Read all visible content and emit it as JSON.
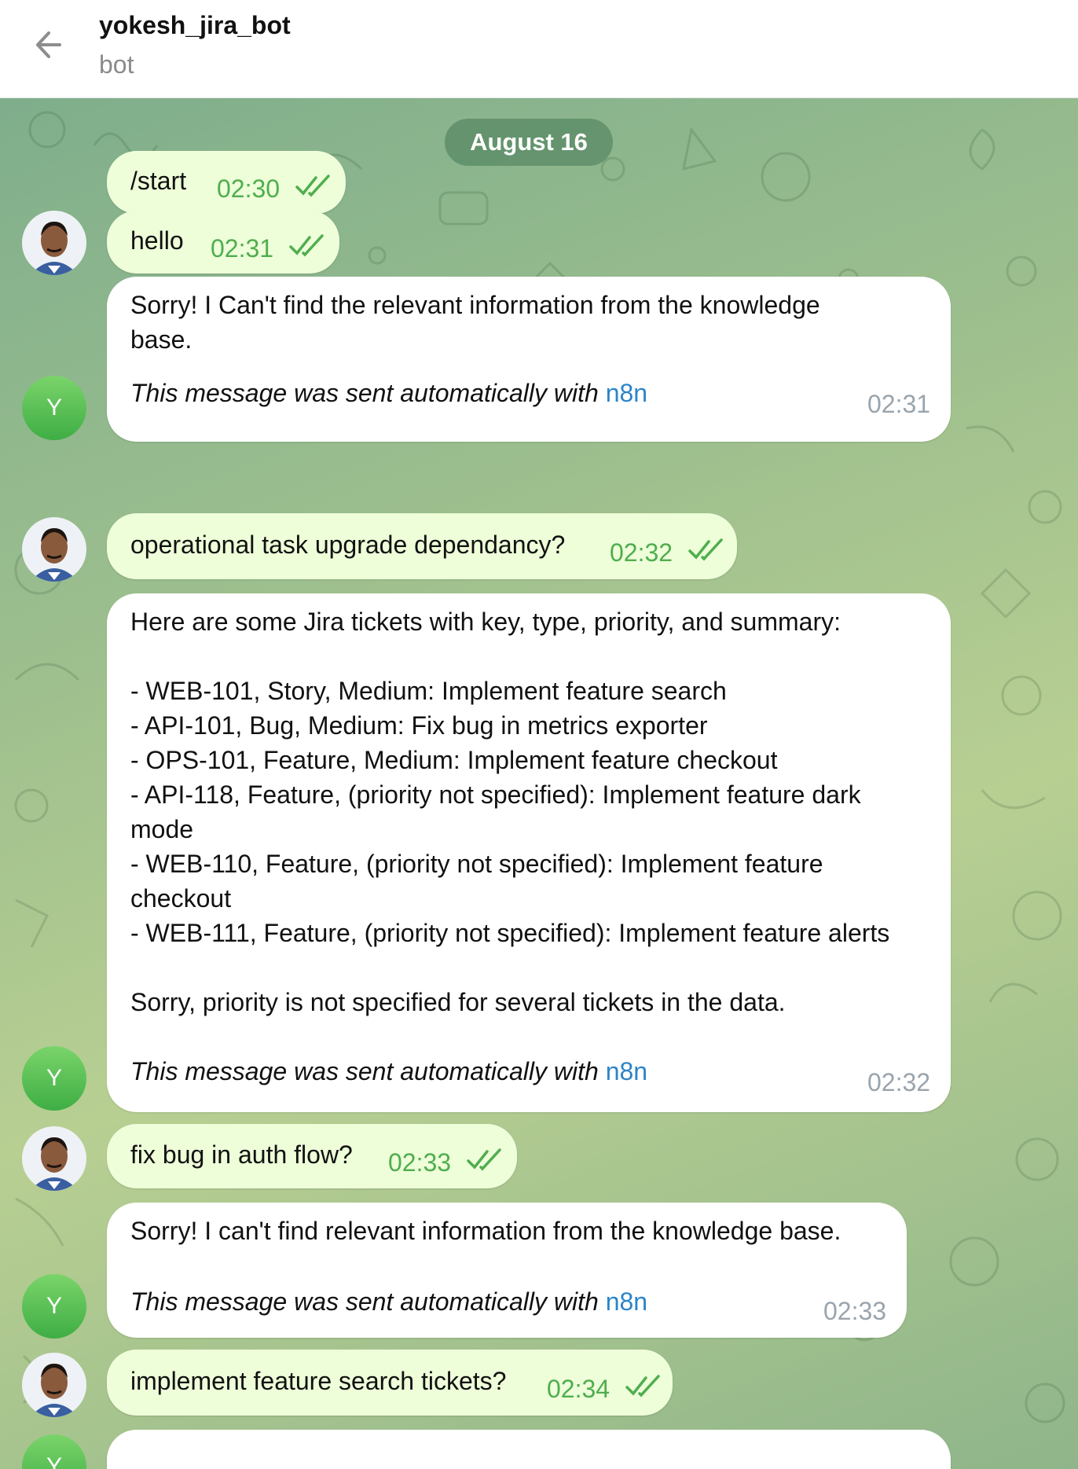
{
  "header": {
    "title": "yokesh_jira_bot",
    "subtitle": "bot"
  },
  "chat": {
    "date_label": "August 16",
    "bot_avatar_letter": "Y",
    "auto_prefix": "This message was sent automatically with",
    "auto_link": "n8n",
    "messages": [
      {
        "text": "/start",
        "time": "02:30"
      },
      {
        "text": "hello",
        "time": "02:31"
      },
      {
        "text": "Sorry! I Can't find the relevant information from the knowledge base.",
        "time": "02:31"
      },
      {
        "text": "operational task upgrade dependancy?",
        "time": "02:32"
      },
      {
        "text": "Here are some Jira tickets with key, type, priority, and summary:\n\n- WEB-101, Story, Medium: Implement feature search\n- API-101, Bug, Medium: Fix bug in metrics exporter\n- OPS-101, Feature, Medium: Implement feature checkout\n- API-118, Feature, (priority not specified): Implement feature dark mode\n- WEB-110, Feature, (priority not specified): Implement feature checkout\n- WEB-111, Feature, (priority not specified): Implement feature alerts\n\nSorry, priority is not specified for several tickets in the data.",
        "time": "02:32"
      },
      {
        "text": "fix bug in auth flow?",
        "time": "02:33"
      },
      {
        "text": "Sorry! I can't find relevant information from the knowledge base.",
        "time": "02:33"
      },
      {
        "text": "implement feature search tickets?",
        "time": "02:34"
      }
    ]
  },
  "colors": {
    "outgoing_bubble": "#eefed9",
    "incoming_bubble": "#ffffff",
    "time_outgoing": "#4fae4e",
    "time_incoming": "#9aa4ad",
    "link": "#2b84c9",
    "chat_bg": "#9fc08e"
  }
}
